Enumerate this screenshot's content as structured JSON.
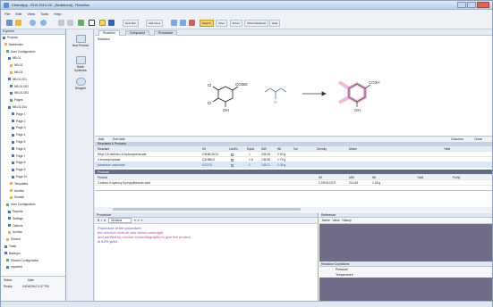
{
  "window": {
    "title": "ChemApp - ELN 2010-02 - [Notebook] - Reaction"
  },
  "menu": [
    "File",
    "Edit",
    "View",
    "Tools",
    "Help"
  ],
  "toolbar": {
    "buttons": [
      "New Rxn",
      "Add Lines",
      "Search",
      "Save",
      "Enum",
      "Show Notebook",
      "Help"
    ],
    "highlighted": "Search"
  },
  "left_panel": {
    "header": "Explorer",
    "tree": [
      "Projects",
      "Notebooks",
      "User Configuration",
      "NB-01",
      "NB-02",
      "NB-03",
      "NB-01-001",
      "NB-01-002",
      "NB-01-003",
      "Pages",
      "NB-01-004",
      "Page 1",
      "Page 2",
      "Page 3",
      "Page 4",
      "Page 5",
      "Page 6",
      "Page 7",
      "Page 8",
      "Page 9",
      "Page 10",
      "Templates",
      "Archive",
      "Scratch",
      "User Configuration",
      "Reports",
      "Settings",
      "Options",
      "Archive",
      "Shared",
      "Trash",
      "Backups",
      "Shared Configuration",
      "Imported"
    ],
    "bottom": {
      "row1": [
        "Status",
        "Date"
      ],
      "row2": [
        "Ready",
        "04/04/2010 2:37 PM"
      ]
    }
  },
  "side_buttons": [
    "New Product",
    "Batch Synthesis",
    "Reagent"
  ],
  "tabs": [
    "Reaction",
    "Compound",
    "Procedure"
  ],
  "reaction_label": "Reaction",
  "reactants": {
    "r1_label_top": "CO2Et",
    "r1_cl1": "Cl",
    "r1_cl2": "Cl",
    "r1_oh": "OH",
    "r2_o": "O",
    "product_top": "CO2H",
    "product_oh": "OH"
  },
  "grid": {
    "toolbar": [
      "Add",
      "Sort Add",
      "Columns",
      "Close"
    ],
    "section": "Reactants & Products",
    "columns": [
      "Reactant",
      "Mf",
      "Lim/Ex",
      "Equiv",
      "MW",
      "Wt",
      "Vol",
      "Density",
      "Moles",
      "Yield"
    ],
    "rows": [
      {
        "name": "Ethyl 3,5-dichloro-4-hydroxybenzoate",
        "mf": "C9H8Cl2O3",
        "equiv": "1",
        "mw": "235.06",
        "wt": "2.00 g"
      },
      {
        "name": "3-bromopropanal",
        "mf": "C3H5BrO",
        "equiv": "1.5",
        "mw": "136.98",
        "wt": "1.75 g"
      },
      {
        "name": "potassium carbonate",
        "mf": "K2CO3",
        "equiv": "2",
        "mw": "138.21",
        "wt": "2.35 g"
      }
    ],
    "product_section": "Products",
    "product_columns": [
      "Product",
      "Mf",
      "MW",
      "Wt",
      "Yield",
      "Purity"
    ],
    "products": [
      {
        "name": "3-chloro-4-hydroxy-5-propylbenzoic acid",
        "mf": "C10H11ClO3",
        "mw": "214.65",
        "wt": "1.48 g"
      }
    ]
  },
  "editor": {
    "title": "Procedure",
    "font_select": "Verdana",
    "lines": [
      {
        "text": "Procedure of the procedure",
        "style": "blue"
      },
      {
        "text": "the reaction mixture was stirred overnight",
        "style": "pink"
      },
      {
        "text": "and purified by column chromatography to give the product",
        "style": "pink"
      },
      {
        "text": "in 62% yield.",
        "style": "blue"
      }
    ]
  },
  "right_panel": {
    "header": "Reference",
    "tabs": [
      "Name",
      "Value",
      "History"
    ],
    "section": "Reaction Conditions",
    "fields": [
      "Pressure",
      "Temperature"
    ]
  }
}
